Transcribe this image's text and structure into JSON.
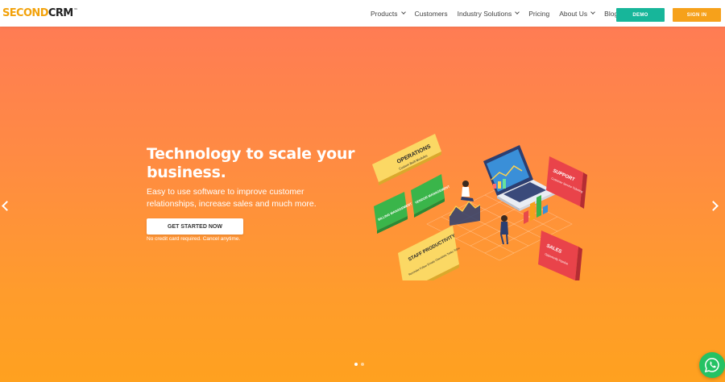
{
  "header": {
    "logo": {
      "part1": "SECOND",
      "part2": "CRM",
      "tm": "™"
    },
    "nav": [
      {
        "label": "Products",
        "dropdown": true
      },
      {
        "label": "Customers",
        "dropdown": false
      },
      {
        "label": "Industry Solutions",
        "dropdown": true
      },
      {
        "label": "Pricing",
        "dropdown": false
      },
      {
        "label": "About Us",
        "dropdown": true
      },
      {
        "label": "Blogs",
        "dropdown": false
      }
    ],
    "demo_label": "DEMO",
    "signin_label": "SIGN IN"
  },
  "hero": {
    "title": "Technology to scale your business.",
    "subtitle": "Easy to use software to improve customer relationships, increase sales and much more.",
    "cta_label": "GET STARTED NOW",
    "note": "No credit card required. Cancel anytime.",
    "slides_total": 2,
    "active_slide": 1
  },
  "illustration": {
    "cards": [
      {
        "title": "OPERATIONS",
        "sub": "Custom Built Modules"
      },
      {
        "title": "BILLING MANAGEMENT",
        "sub": ""
      },
      {
        "title": "VENDOR MANAGEMENT",
        "sub": ""
      },
      {
        "title": "STAFF PRODUCTIVITY",
        "sub": "Reminder  Follow  Emails  Checklists  Tasks  ToDo"
      },
      {
        "title": "SUPPORT",
        "sub": "Customer Service  Ticketing"
      },
      {
        "title": "SALES",
        "sub": "Opportunity Pipeline"
      }
    ]
  },
  "colors": {
    "accent_teal": "#17b69a",
    "accent_orange": "#f6a11b",
    "hero_top": "#ff7c54",
    "hero_bottom": "#ffa11f",
    "card_yellow": "#fbd864",
    "card_green": "#3ab54a",
    "card_red": "#e9434a",
    "whatsapp_green": "#25c264"
  },
  "icons": {
    "prev": "chevron-left-icon",
    "next": "chevron-right-icon",
    "chat": "whatsapp-icon"
  }
}
